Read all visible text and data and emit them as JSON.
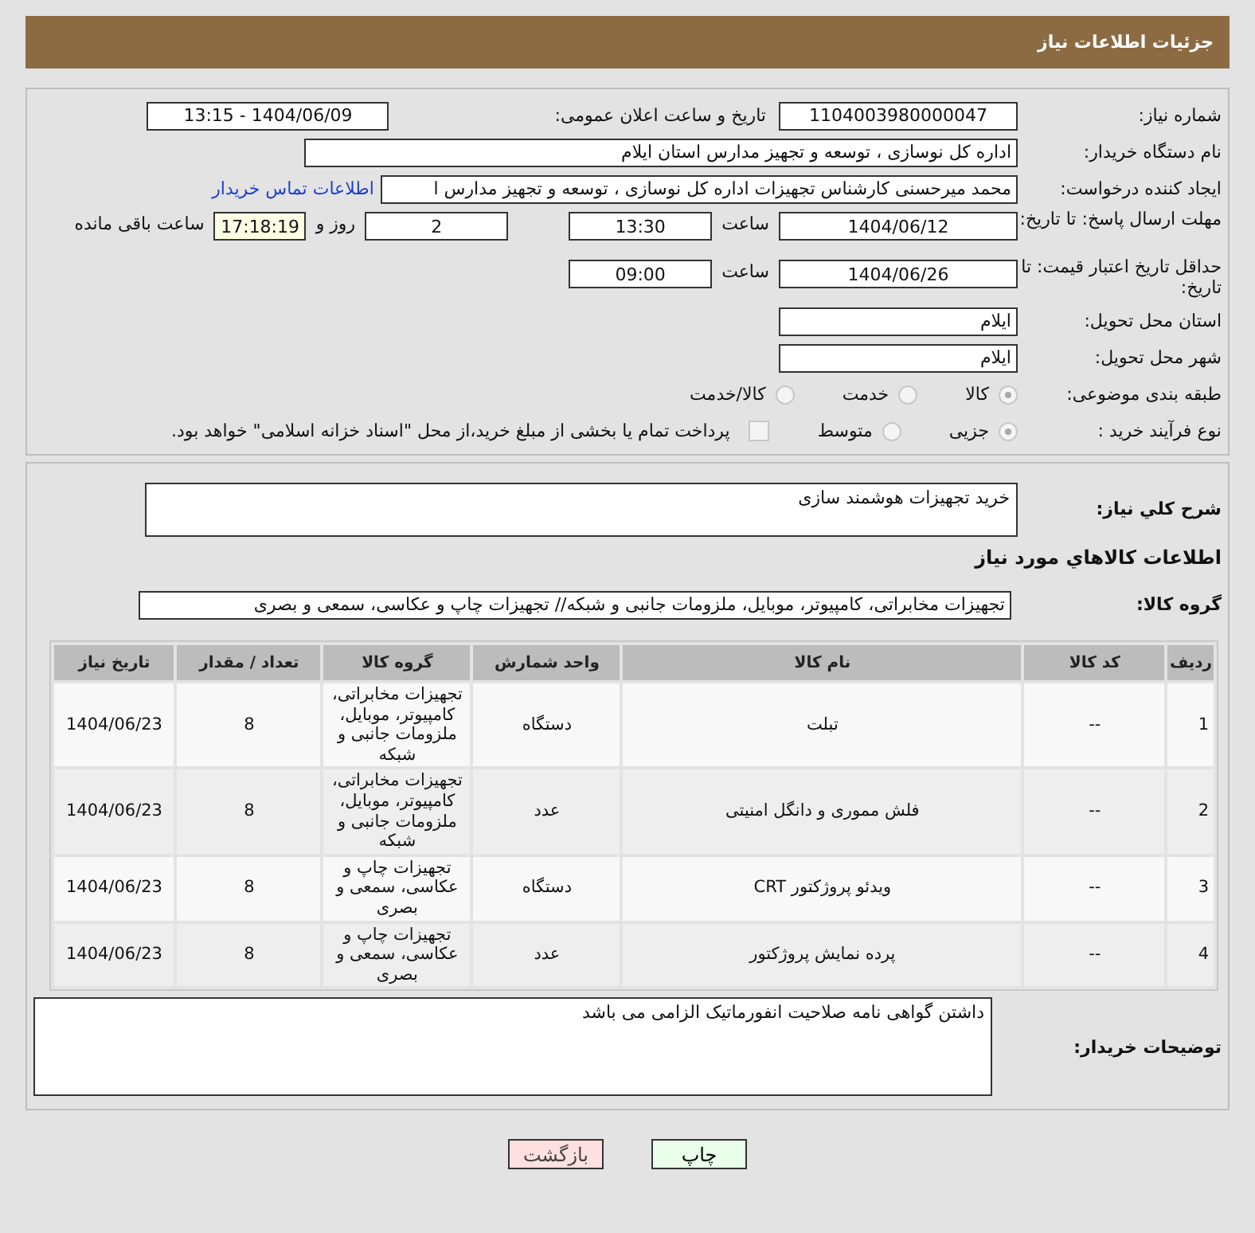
{
  "title": "جزئیات اطلاعات نیاز",
  "need_number": {
    "label": "شماره نیاز:",
    "value": "1104003980000047"
  },
  "announce": {
    "label": "تاریخ و ساعت اعلان عمومی:",
    "value": "1404/06/09 - 13:15"
  },
  "buyer_org": {
    "label": "نام دستگاه خریدار:",
    "value": "اداره کل نوسازی ، توسعه و تجهیز مدارس استان ایلام"
  },
  "requester": {
    "label": "ایجاد کننده درخواست:",
    "value": "محمد میرحسنی کارشناس تجهیزات اداره کل نوسازی ، توسعه و تجهیز مدارس ا",
    "link": "اطلاعات تماس خریدار"
  },
  "deadline": {
    "label": "مهلت ارسال پاسخ: تا تاریخ:",
    "date": "1404/06/12",
    "time_label": "ساعت",
    "time": "13:30",
    "days": "2",
    "days_label": "روز و",
    "remaining": "17:18:19",
    "remaining_label": "ساعت باقی مانده"
  },
  "validity": {
    "label": "حداقل تاریخ اعتبار قیمت: تا تاریخ:",
    "date": "1404/06/26",
    "time_label": "ساعت",
    "time": "09:00"
  },
  "province": {
    "label": "استان محل تحویل:",
    "value": "ایلام"
  },
  "city": {
    "label": "شهر محل تحویل:",
    "value": "ایلام"
  },
  "category": {
    "label": "طبقه بندی موضوعی:",
    "options": [
      {
        "label": "کالا",
        "selected": true
      },
      {
        "label": "خدمت",
        "selected": false
      },
      {
        "label": "کالا/خدمت",
        "selected": false
      }
    ]
  },
  "process": {
    "label": "نوع فرآیند خرید :",
    "options": [
      {
        "label": "جزیی",
        "selected": true
      },
      {
        "label": "متوسط",
        "selected": false
      }
    ],
    "payment": {
      "checked": false,
      "text": "پرداخت تمام یا بخشی از مبلغ خرید،از محل \"اسناد خزانه اسلامی\" خواهد بود."
    }
  },
  "description": {
    "label": "شرح کلي نياز:",
    "value": "خرید تجهیزات هوشمند سازی"
  },
  "goods_title": "اطلاعات کالاهاي مورد نياز",
  "goods_group": {
    "label": "گروه کالا:",
    "value": "تجهیزات مخابراتی، کامپیوتر، موبایل، ملزومات جانبی و شبکه// تجهیزات چاپ و عکاسی، سمعی و بصری"
  },
  "table": {
    "columns": [
      "ردیف",
      "کد کالا",
      "نام کالا",
      "واحد شمارش",
      "گروه کالا",
      "تعداد / مقدار",
      "تاریخ نیاز"
    ],
    "rows": [
      [
        "1",
        "--",
        "تبلت",
        "دستگاه",
        "تجهیزات مخابراتی، کامپیوتر، موبایل، ملزومات جانبی و شبکه",
        "8",
        "1404/06/23"
      ],
      [
        "2",
        "--",
        "فلش مموری و دانگل امنیتی",
        "عدد",
        "تجهیزات مخابراتی، کامپیوتر، موبایل، ملزومات جانبی و شبکه",
        "8",
        "1404/06/23"
      ],
      [
        "3",
        "--",
        "ویدئو پروژکتور CRT",
        "دستگاه",
        "تجهیزات چاپ و عکاسی، سمعی و بصری",
        "8",
        "1404/06/23"
      ],
      [
        "4",
        "--",
        "پرده نمایش پروژکتور",
        "عدد",
        "تجهیزات چاپ و عکاسی، سمعی و بصری",
        "8",
        "1404/06/23"
      ]
    ]
  },
  "buyer_notes": {
    "label": "توضیحات خریدار:",
    "value": "داشتن گواهی نامه صلاحیت انفورماتیک الزامی می باشد"
  },
  "buttons": [
    {
      "label": "چاپ",
      "kind": "print"
    },
    {
      "label": "بازگشت",
      "kind": "back"
    }
  ]
}
